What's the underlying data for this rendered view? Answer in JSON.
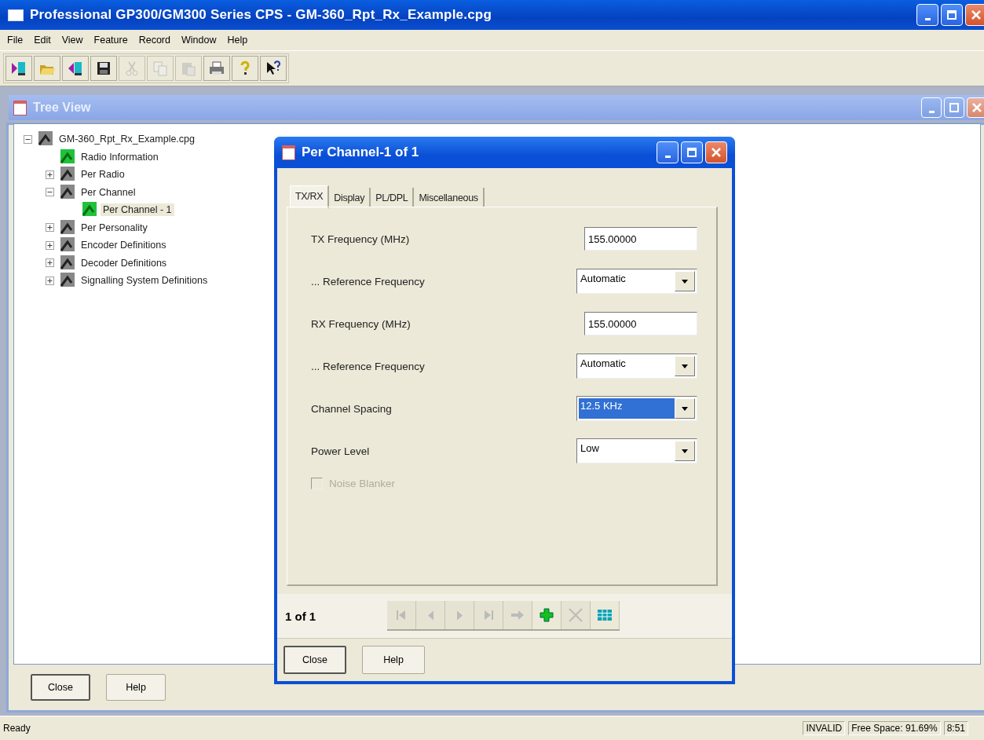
{
  "window": {
    "title": "Professional GP300/GM300 Series CPS - GM-360_Rpt_Rx_Example.cpg"
  },
  "menu": [
    "File",
    "Edit",
    "View",
    "Feature",
    "Record",
    "Window",
    "Help"
  ],
  "toolbar": [
    {
      "kind": "read",
      "disabled": false
    },
    {
      "kind": "open",
      "disabled": false
    },
    {
      "kind": "write",
      "disabled": false
    },
    {
      "kind": "save",
      "disabled": false
    },
    {
      "kind": "cut",
      "disabled": true
    },
    {
      "kind": "copy",
      "disabled": true
    },
    {
      "kind": "paste",
      "disabled": true
    },
    {
      "kind": "print",
      "disabled": false
    },
    {
      "kind": "help",
      "disabled": false
    },
    {
      "kind": "whatsthis",
      "disabled": false
    }
  ],
  "tree_view": {
    "title": "Tree View",
    "tree": [
      {
        "label": "GM-360_Rpt_Rx_Example.cpg",
        "kind": "group",
        "expanded": true,
        "selected": false,
        "children": [
          {
            "label": "Radio Information",
            "kind": "record",
            "selected": false
          },
          {
            "label": "Per Radio",
            "kind": "group",
            "expanded": false,
            "selected": false
          },
          {
            "label": "Per Channel",
            "kind": "group",
            "expanded": true,
            "selected": false,
            "children": [
              {
                "label": "Per Channel - 1",
                "kind": "record",
                "selected": true
              }
            ]
          },
          {
            "label": "Per Personality",
            "kind": "group",
            "expanded": false,
            "selected": false
          },
          {
            "label": "Encoder Definitions",
            "kind": "group",
            "expanded": false,
            "selected": false
          },
          {
            "label": "Decoder Definitions",
            "kind": "group",
            "expanded": false,
            "selected": false
          },
          {
            "label": "Signalling System Definitions",
            "kind": "group",
            "expanded": false,
            "selected": false
          }
        ]
      }
    ],
    "buttons": [
      "Close",
      "Help"
    ]
  },
  "dialog": {
    "title": "Per Channel-1 of 1",
    "tabs": [
      {
        "label": "TX/RX",
        "selected": true
      },
      {
        "label": "Display",
        "selected": false
      },
      {
        "label": "PL/DPL",
        "selected": false
      },
      {
        "label": "Miscellaneous",
        "selected": false
      }
    ],
    "fields": [
      {
        "kind": "text",
        "label": "TX Frequency (MHz)",
        "value": "155.00000"
      },
      {
        "kind": "combo",
        "label": "... Reference Frequency",
        "value": "Automatic",
        "focused": false
      },
      {
        "kind": "text",
        "label": "RX Frequency (MHz)",
        "value": "155.00000"
      },
      {
        "kind": "combo",
        "label": "... Reference Frequency",
        "value": "Automatic",
        "focused": false
      },
      {
        "kind": "combo",
        "label": "Channel Spacing",
        "value": "12.5 KHz",
        "focused": true
      },
      {
        "kind": "combo",
        "label": "Power Level",
        "value": "Low",
        "focused": false
      },
      {
        "kind": "checkbox",
        "label": "Noise Blanker",
        "checked": false,
        "disabled": true
      }
    ],
    "record_counter": "1 of 1",
    "navigation": [
      {
        "kind": "first",
        "disabled": true
      },
      {
        "kind": "previous",
        "disabled": true
      },
      {
        "kind": "next",
        "disabled": true
      },
      {
        "kind": "last",
        "disabled": true
      },
      {
        "kind": "goto",
        "disabled": true
      },
      {
        "kind": "add",
        "disabled": false
      },
      {
        "kind": "delete",
        "disabled": true
      },
      {
        "kind": "grid",
        "disabled": false
      }
    ],
    "buttons": [
      "Close",
      "Help"
    ]
  },
  "status_bar": {
    "message": "Ready",
    "panes": [
      "INVALID",
      "Free Space: 91.69%",
      "8:51"
    ]
  }
}
